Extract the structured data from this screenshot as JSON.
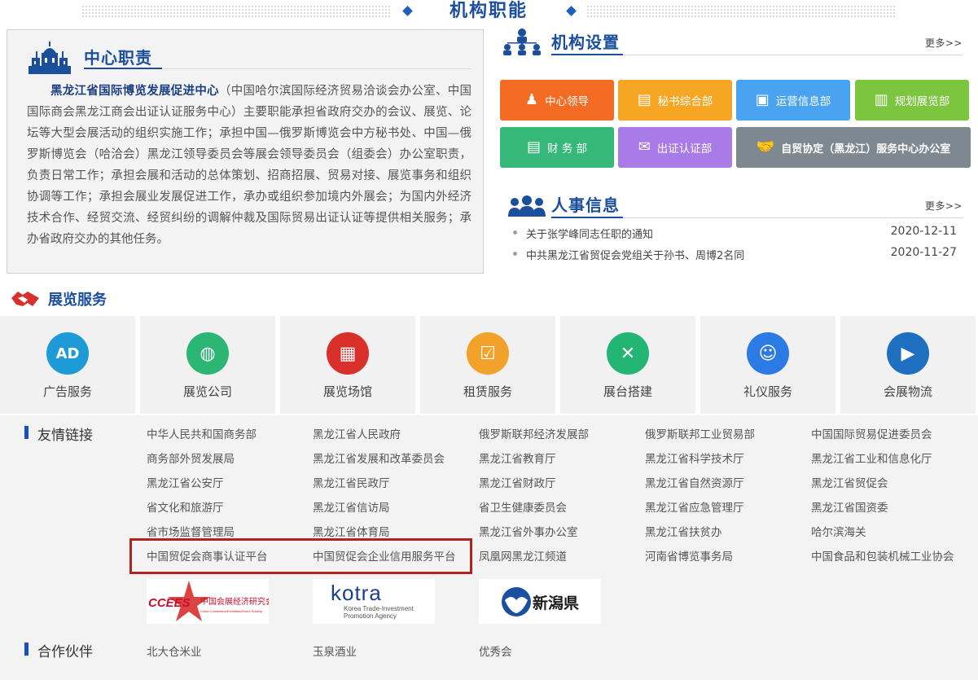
{
  "header": {
    "title": "机构职能"
  },
  "duties": {
    "title": "中心职责",
    "org_name": "黑龙江省国际博览发展促进中心",
    "body": "（中国哈尔滨国际经济贸易洽谈会办公室、中国国际商会黑龙江商会出证认证服务中心）主要职能承担省政府交办的会议、展览、论坛等大型会展活动的组织实施工作；承担中国—俄罗斯博览会中方秘书处、中国—俄罗斯博览会（哈洽会）黑龙江领导委员会等展会领导委员会（组委会）办公室职责，负责日常工作；承担会展和活动的总体策划、招商招展、贸易对接、展览事务和组织协调等工作；承担会展业发展促进工作，承办或组织参加境内外展会；为国内外经济技术合作、经贸交流、经贸纠纷的调解仲裁及国际贸易出证认证等提供相关服务；承办省政府交办的其他任务。"
  },
  "org_setup": {
    "title": "机构设置",
    "more": "更多>>",
    "departments": [
      {
        "label": "中心领导",
        "color": "#f46b23",
        "icon": "person-badge-icon"
      },
      {
        "label": "秘书综合部",
        "color": "#f6a623",
        "icon": "book-icon"
      },
      {
        "label": "运营信息部",
        "color": "#4aa3f0",
        "icon": "info-card-icon"
      },
      {
        "label": "规划展览部",
        "color": "#7cc53f",
        "icon": "tray-icon"
      },
      {
        "label": "财 务 部",
        "color": "#35b87a",
        "icon": "document-icon"
      },
      {
        "label": "出证认证部",
        "color": "#a97be8",
        "icon": "mail-tray-icon"
      },
      {
        "label": "自贸协定（黑龙江）服务中心办公室",
        "color": "#7e8891",
        "icon": "handshake-icon"
      }
    ]
  },
  "personnel": {
    "title": "人事信息",
    "more": "更多>>",
    "items": [
      {
        "text": "关于张学峰同志任职的通知",
        "date": "2020-12-11"
      },
      {
        "text": "中共黑龙江省贸促会党组关于孙书、周博2名同",
        "date": "2020-11-27"
      }
    ]
  },
  "services": {
    "title": "展览服务",
    "items": [
      {
        "label": "广告服务",
        "color": "#1e9bd7",
        "icon": "ad-icon",
        "glyph": "AD"
      },
      {
        "label": "展览公司",
        "color": "#2bb673",
        "icon": "globe-person-icon",
        "glyph": "◍"
      },
      {
        "label": "展览场馆",
        "color": "#d9302c",
        "icon": "stadium-icon",
        "glyph": "▦"
      },
      {
        "label": "租赁服务",
        "color": "#f2a22a",
        "icon": "clipboard-icon",
        "glyph": "☑"
      },
      {
        "label": "展台搭建",
        "color": "#22b573",
        "icon": "tools-icon",
        "glyph": "✕"
      },
      {
        "label": "礼仪服务",
        "color": "#2c7be5",
        "icon": "hostess-icon",
        "glyph": "☺"
      },
      {
        "label": "会展物流",
        "color": "#1e6fc0",
        "icon": "truck-icon",
        "glyph": "▶"
      }
    ]
  },
  "friend_links": {
    "title": "友情链接",
    "rows": [
      [
        "中华人民共和国商务部",
        "黑龙江省人民政府",
        "俄罗斯联邦经济发展部",
        "俄罗斯联邦工业贸易部",
        "中国国际贸易促进委员会"
      ],
      [
        "商务部外贸发展局",
        "黑龙江省发展和改革委员会",
        "黑龙江省教育厅",
        "黑龙江省科学技术厅",
        "黑龙江省工业和信息化厅"
      ],
      [
        "黑龙江省公安厅",
        "黑龙江省民政厅",
        "黑龙江省财政厅",
        "黑龙江省自然资源厅",
        "黑龙江省贸促会"
      ],
      [
        "省文化和旅游厅",
        "黑龙江省信访局",
        "省卫生健康委员会",
        "黑龙江省应急管理厅",
        "黑龙江省国资委"
      ],
      [
        "省市场监督管理局",
        "黑龙江省体育局",
        "黑龙江省外事办公室",
        "黑龙江省扶贫办",
        "哈尔滨海关"
      ],
      [
        "中国贸促会商事认证平台",
        "中国贸促会企业信用服务平台",
        "凤凰网黑龙江频道",
        "河南省博览事务局",
        "中国食品和包装机械工业协会"
      ]
    ],
    "logos": {
      "ccees": {
        "mark": "CCEES",
        "cn": "中国会展经济研究会",
        "en": "China Convention/Exhibition/Event Society"
      },
      "kotra": {
        "mark": "kotra",
        "line1": "Korea Trade-Investment",
        "line2": "Promotion Agency"
      },
      "niigata": {
        "mark": "新潟県"
      }
    }
  },
  "partners": {
    "title": "合作伙伴",
    "items": [
      "北大仓米业",
      "玉泉酒业",
      "优秀会"
    ]
  }
}
